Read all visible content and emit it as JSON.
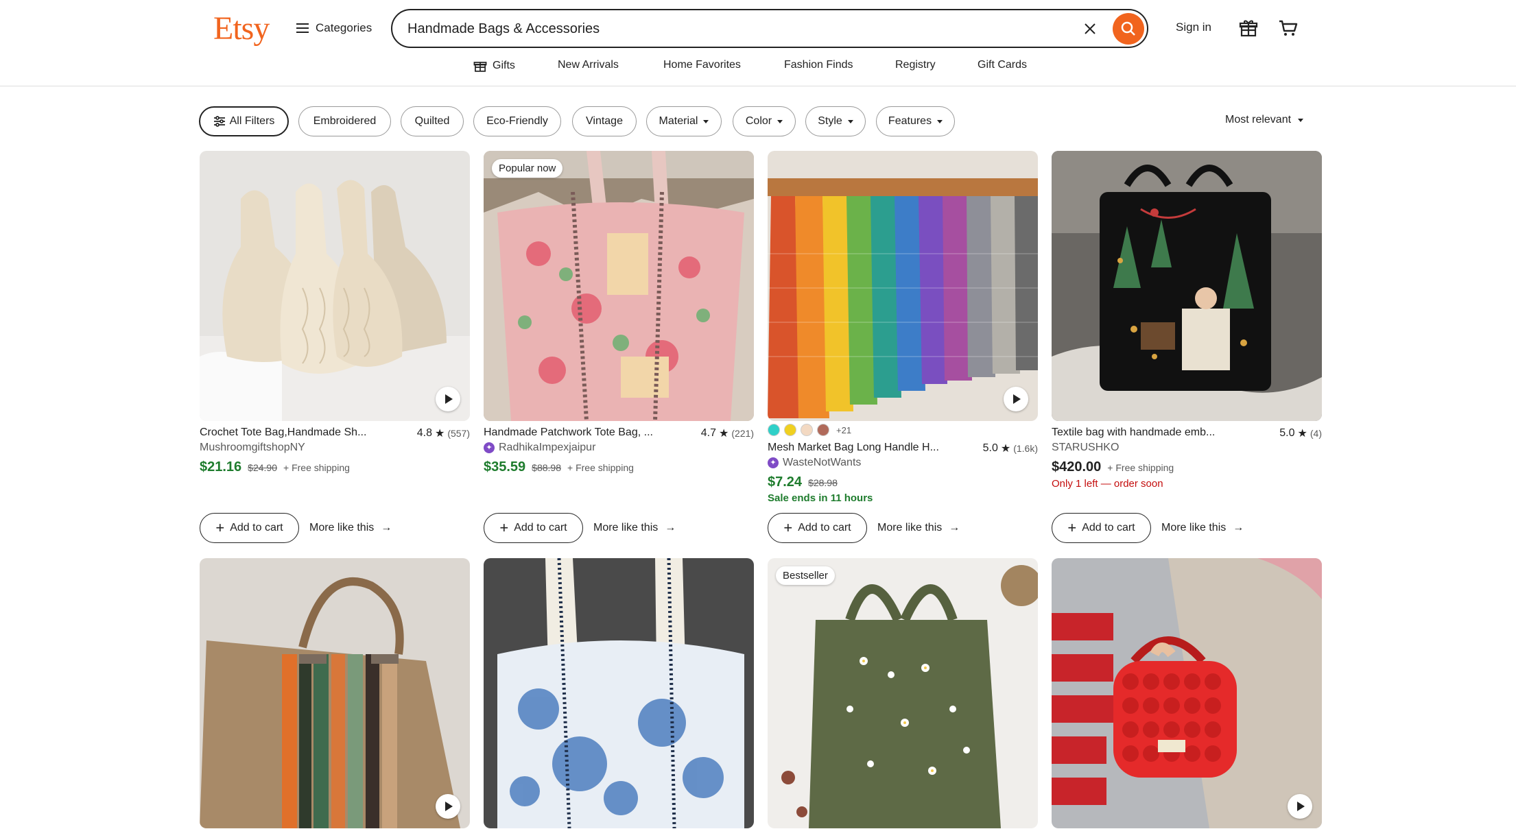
{
  "header": {
    "logo": "Etsy",
    "categories_label": "Categories",
    "search_value": "Handmade Bags & Accessories",
    "signin_label": "Sign in",
    "colors": {
      "brand": "#f1641e"
    }
  },
  "subnav": {
    "items": [
      {
        "label": "Gifts",
        "icon": "gift-icon"
      },
      {
        "label": "New Arrivals"
      },
      {
        "label": "Home Favorites"
      },
      {
        "label": "Fashion Finds"
      },
      {
        "label": "Registry"
      },
      {
        "label": "Gift Cards"
      }
    ]
  },
  "filters": {
    "all_filters": "All Filters",
    "pills": [
      "Embroidered",
      "Quilted",
      "Eco-Friendly",
      "Vintage",
      "Material",
      "Color",
      "Style",
      "Features"
    ],
    "sort_label": "Most relevant"
  },
  "listings": [
    {
      "title": "Crochet Tote Bag,Handmade Sh...",
      "rating": "4.8",
      "reviews": "(557)",
      "shop": "MushroomgiftshopNY",
      "price": "$21.16",
      "original_price": "$24.90",
      "shipping": "+ Free shipping",
      "add_to_cart": "Add to cart",
      "more_like_this": "More like this"
    },
    {
      "badge": "Popular now",
      "title": "Handmade Patchwork Tote Bag, ...",
      "rating": "4.7",
      "reviews": "(221)",
      "shop": "RadhikaImpexjaipur",
      "price": "$35.59",
      "original_price": "$88.98",
      "shipping": "+ Free shipping",
      "add_to_cart": "Add to cart",
      "more_like_this": "More like this"
    },
    {
      "swatches_more": "+21",
      "swatch_colors": [
        "#2fd0c8",
        "#f0d020",
        "#f3d9c2",
        "#b06a5a"
      ],
      "title": "Mesh Market Bag Long Handle H...",
      "rating": "5.0",
      "reviews": "(1.6k)",
      "shop": "WasteNotWants",
      "price": "$7.24",
      "original_price": "$28.98",
      "sale_note": "Sale ends in 11 hours",
      "add_to_cart": "Add to cart",
      "more_like_this": "More like this"
    },
    {
      "title": "Textile bag with handmade emb...",
      "rating": "5.0",
      "reviews": "(4)",
      "shop": "STARUSHKO",
      "price": "$420.00",
      "shipping": "+ Free shipping",
      "stock_note": "Only 1 left — order soon",
      "add_to_cart": "Add to cart",
      "more_like_this": "More like this"
    },
    {},
    {},
    {
      "badge": "Bestseller"
    },
    {}
  ]
}
